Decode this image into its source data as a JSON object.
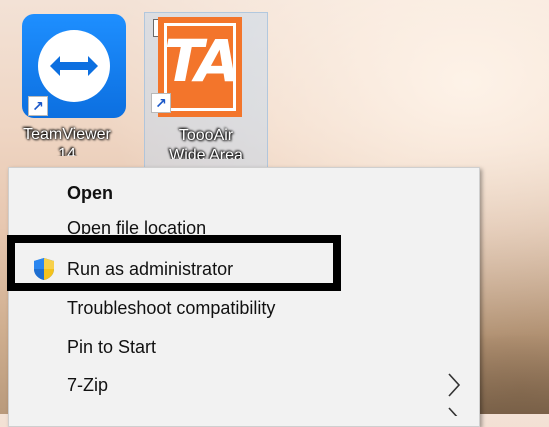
{
  "desktop": {
    "icons": [
      {
        "label_line1": "TeamViewer",
        "label_line2": "14",
        "icon": "teamviewer-icon"
      },
      {
        "label_line1": "ToooAir",
        "label_line2": "Wide Area",
        "icon": "toooair-icon",
        "tile_text": "TA",
        "selected": true
      }
    ]
  },
  "context_menu": {
    "items": [
      {
        "label": "Open",
        "bold": true
      },
      {
        "label": "Open file location"
      },
      {
        "label": "Run as administrator",
        "icon": "uac-shield-icon"
      },
      {
        "label": "Troubleshoot compatibility"
      },
      {
        "label": "Pin to Start"
      },
      {
        "label": "7-Zip",
        "has_submenu": true
      }
    ]
  },
  "colors": {
    "teamviewer_blue": "#0c6fe0",
    "toooair_orange": "#f3752b",
    "highlight_box": "#000000",
    "menu_bg": "#f2f2f2"
  }
}
